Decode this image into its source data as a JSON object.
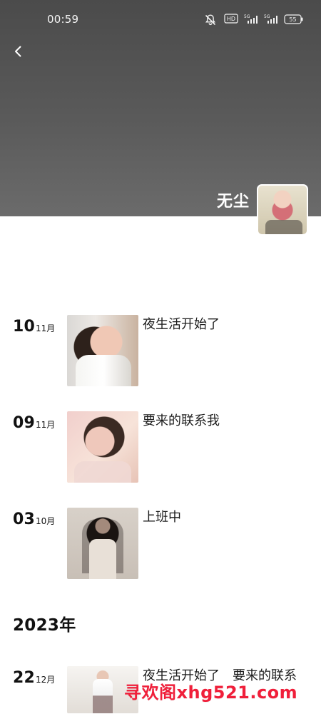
{
  "status_bar": {
    "time": "00:59",
    "battery_level": "55",
    "icons": [
      "mute-bell-icon",
      "hd-icon",
      "signal-5g-icon",
      "signal-5g-icon",
      "battery-icon"
    ]
  },
  "profile": {
    "name": "无尘"
  },
  "feed": {
    "posts": [
      {
        "day": "10",
        "month": "11月",
        "text": "夜生活开始了"
      },
      {
        "day": "09",
        "month": "11月",
        "text": "要来的联系我"
      },
      {
        "day": "03",
        "month": "10月",
        "text": "上班中"
      },
      {
        "day": "22",
        "month": "12月",
        "text": "夜生活开始了　要来的联系"
      }
    ],
    "year_label": "2023年"
  },
  "watermark": {
    "text": "寻欢阁xhg521.com",
    "color": "#f01f3a"
  }
}
